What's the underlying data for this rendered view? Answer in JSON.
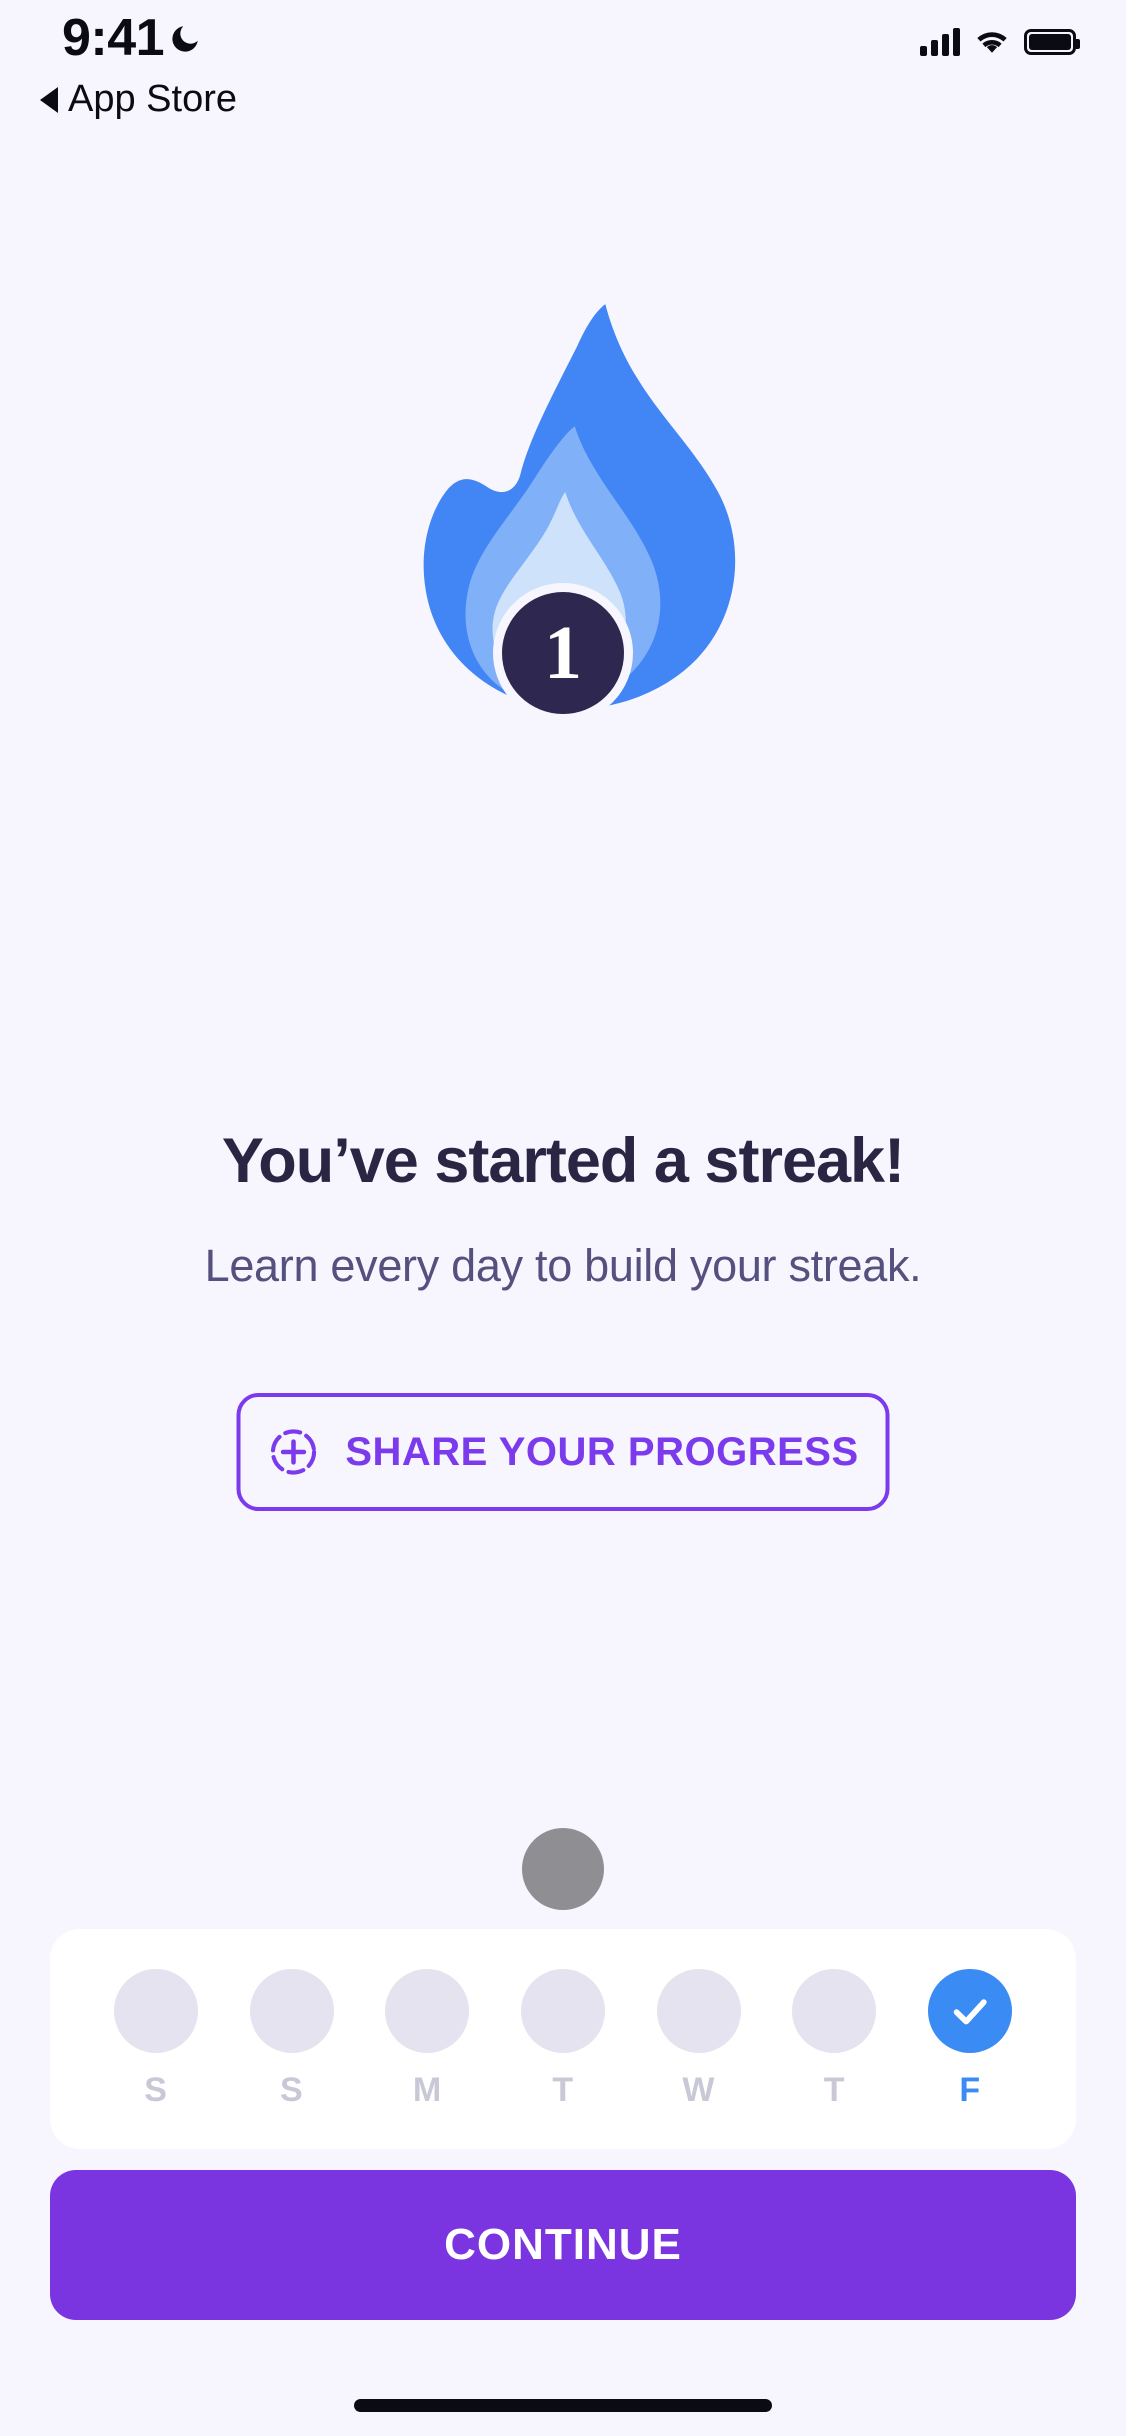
{
  "status_bar": {
    "time": "9:41",
    "moon_icon": "crescent-moon-icon",
    "signal_icon": "cellular-signal-icon",
    "wifi_icon": "wifi-icon",
    "battery_icon": "battery-full-icon"
  },
  "back_nav": {
    "arrow_icon": "back-triangle-icon",
    "label": "App Store"
  },
  "illustration": {
    "name": "streak-flame-illustration",
    "outer_color": "#4285f4",
    "mid_color": "#7fb0f8",
    "inner_color": "#cfe2fb",
    "badge_color": "#2e2850",
    "badge_ring_color": "#f7f5fd",
    "streak_count": "1"
  },
  "content": {
    "headline": "You’ve started a streak!",
    "subtitle": "Learn every day to build your streak."
  },
  "share_button": {
    "icon": "plus-in-dashed-circle-icon",
    "label": "SHARE YOUR PROGRESS",
    "accent_color": "#7c3aed"
  },
  "loading_dot": {
    "name": "gray-circle-placeholder",
    "color": "#8e8e93"
  },
  "week_tracker": {
    "card_color": "#ffffff",
    "inactive_color": "#e4e3ef",
    "active_color": "#3b8bf5",
    "label_color": "#c9c8d6",
    "days": [
      {
        "label": "S",
        "active": false
      },
      {
        "label": "S",
        "active": false
      },
      {
        "label": "M",
        "active": false
      },
      {
        "label": "T",
        "active": false
      },
      {
        "label": "W",
        "active": false
      },
      {
        "label": "T",
        "active": false
      },
      {
        "label": "F",
        "active": true
      }
    ]
  },
  "continue_button": {
    "label": "CONTINUE",
    "color": "#7b35e0"
  },
  "home_indicator": {
    "name": "home-indicator-bar"
  }
}
